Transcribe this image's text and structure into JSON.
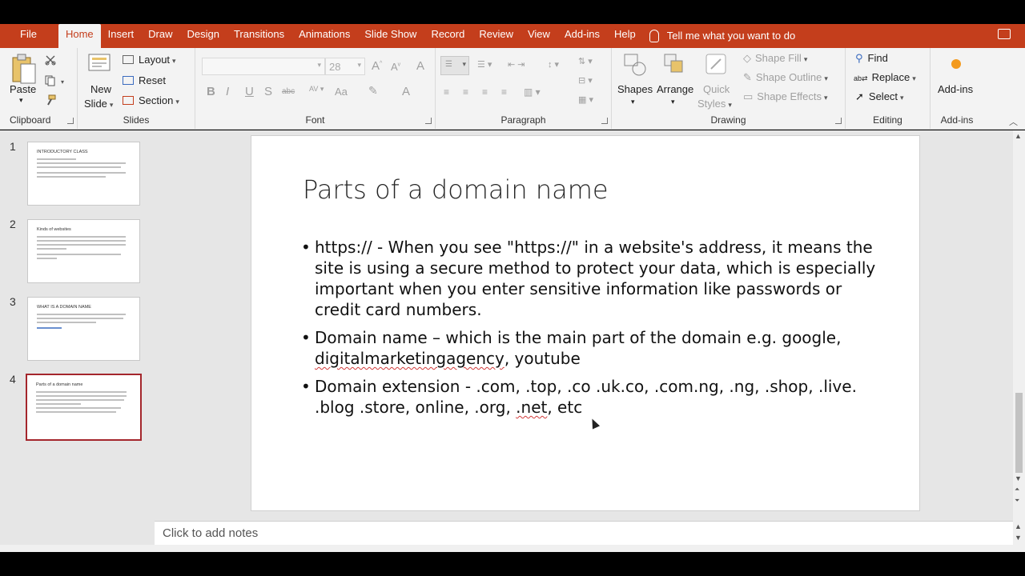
{
  "menu": {
    "tabs": [
      "File",
      "Home",
      "Insert",
      "Draw",
      "Design",
      "Transitions",
      "Animations",
      "Slide Show",
      "Record",
      "Review",
      "View",
      "Add-ins",
      "Help"
    ],
    "active_tab": "Home",
    "tell_me": "Tell me what you want to do"
  },
  "ribbon": {
    "clipboard": {
      "label": "Clipboard",
      "paste": "Paste"
    },
    "slides": {
      "label": "Slides",
      "new_slide_1": "New",
      "new_slide_2": "Slide",
      "layout": "Layout",
      "reset": "Reset",
      "section": "Section"
    },
    "font": {
      "label": "Font",
      "size": "28",
      "bold": "B",
      "italic": "I",
      "underline": "U",
      "strike": "S",
      "abc": "abc",
      "case": "Aa",
      "color": "A"
    },
    "paragraph": {
      "label": "Paragraph"
    },
    "drawing": {
      "label": "Drawing",
      "shapes": "Shapes",
      "arrange": "Arrange",
      "quick_1": "Quick",
      "quick_2": "Styles",
      "shape_fill": "Shape Fill",
      "shape_outline": "Shape Outline",
      "shape_effects": "Shape Effects"
    },
    "editing": {
      "label": "Editing",
      "find": "Find",
      "replace": "Replace",
      "select": "Select"
    },
    "addins": {
      "label": "Add-ins",
      "button": "Add-ins"
    }
  },
  "thumbnails": [
    {
      "num": "1",
      "title": "INTRODUCTORY CLASS"
    },
    {
      "num": "2",
      "title": "Kinds of websites"
    },
    {
      "num": "3",
      "title": "WHAT IS A DOMAIN NAME"
    },
    {
      "num": "4",
      "title": "Parts of a domain name"
    }
  ],
  "slide": {
    "title": "Parts of a domain name",
    "bullet_1": "https:// - When you see \"https://\" in a website's address, it means the site is using a secure method to protect your data, which is especially important when you enter sensitive information like passwords or credit card numbers.",
    "bullet_2_pre": "Domain name – which is the main part of the domain e.g. google, ",
    "bullet_2_squig": "digitalmarketingagency",
    "bullet_2_post": ", youtube",
    "bullet_3_pre": "Domain extension - .com, .top, .co .uk.co, .com.ng, .ng, .shop, .live. .blog .store, online, .org, ",
    "bullet_3_squig": ".net",
    "bullet_3_post": ", etc"
  },
  "notes": {
    "placeholder": "Click to add notes"
  },
  "colors": {
    "accent": "#c43e1c",
    "active_thumb": "#a4262c"
  }
}
